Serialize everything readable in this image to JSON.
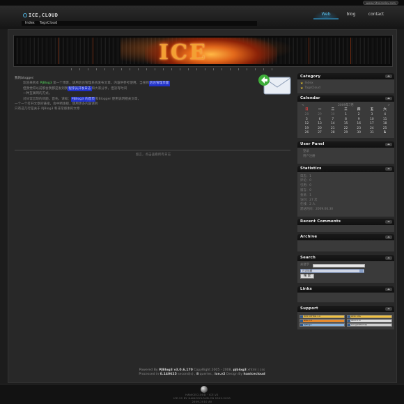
{
  "topbar": {
    "link": "www.nitroicedev.com"
  },
  "header": {
    "logo": "ICE,CLOUD",
    "nav": [
      {
        "label": "Web",
        "active": true
      },
      {
        "label": "blog",
        "active": false
      },
      {
        "label": "contact",
        "active": false
      }
    ],
    "breadcrumb": [
      "Index",
      "TagsCloud"
    ]
  },
  "banner": {
    "text": "ICE"
  },
  "post": {
    "title": "我的blogger:",
    "line1_a": "欢迎来到本 ",
    "line1_b": "PJBlog3",
    "line1_c": " 第一个博客，请用后台管理系统发布文章，内容供参考使用，当搜到",
    "line1_d": "后台管理页面",
    "line2_a": "但我觉得以前那会我都是发到我",
    "line2_b": "程序员开发日志",
    "line2_c": "和大家分享，但没有时间",
    "line3_a": "一种互联网的方式。",
    "line4_a": "对日常出现的问题，首先，请知：",
    "line4_b": "PJBlog3",
    "line4_c": "的首页",
    "line4_d": "和Blogger 使用说明相关文章，",
    "line5": "一个一个打开文章的链接，会中断连接，使用更多内容请到",
    "line6": "只有这几行是关于 PJBlog3 和非常感谢的文章",
    "more": "留言，点击查看所有日志"
  },
  "sidebar": {
    "category": {
      "title": "Category",
      "items": [
        "Index",
        "TagsCloud"
      ]
    },
    "calendar": {
      "title": "Calendar",
      "month": "2009年7月",
      "prev": "<",
      "next": ">",
      "weekdays": [
        "日",
        "一",
        "二",
        "三",
        "四",
        "五",
        "六"
      ],
      "days": [
        "28",
        "29",
        "30",
        "1",
        "2",
        "3",
        "4",
        "5",
        "6",
        "7",
        "8",
        "9",
        "10",
        "11",
        "12",
        "13",
        "14",
        "15",
        "16",
        "17",
        "18",
        "19",
        "20",
        "21",
        "22",
        "23",
        "24",
        "25",
        "26",
        "27",
        "28",
        "29",
        "30",
        "31",
        "1"
      ],
      "today": "1"
    },
    "user_panel": {
      "title": "User Panel",
      "items": [
        "登录",
        "用户注册"
      ]
    },
    "statistics": {
      "title": "Statistics",
      "items": [
        "日志：1",
        "评论：0",
        "引用：0",
        "留言：0",
        "会员：1",
        "访问：27 次",
        "在线：2 人",
        "建站时间：2009.06.30"
      ]
    },
    "recent_comments": {
      "title": "Recent Comments"
    },
    "archive": {
      "title": "Archive"
    },
    "search": {
      "title": "Search",
      "label": "关键字",
      "input_value": "",
      "select_value": "日志标题",
      "button": "搜 索"
    },
    "links": {
      "title": "Links"
    },
    "support": {
      "title": "Support",
      "badges": [
        "W3C XHTML 1.0",
        "W3C CSS",
        "RSS 2.0",
        "Atom 1.0",
        "PJBlog3",
        "GoogleSitemap"
      ]
    }
  },
  "footer": {
    "line1_a": "Powered By ",
    "line1_b": "PJBlog3 v3.0.6.170",
    "line1_c": " CopyRight 2005 - 2008, ",
    "line1_d": "pjblog3",
    "line1_e": " xhtml | css",
    "line2_a": "Processed in ",
    "line2_b": "0.140625",
    "line2_c": " second(s) , ",
    "line2_d": "8",
    "line2_e": " queries , ",
    "line2_f": "ice.v2",
    "line2_g": " Design By ",
    "line2_h": "hanicecloud"
  },
  "bottom": {
    "line1": "HANICECLOUD · ICE.V2",
    "line2": "ICE.V2 BY HANICECLOUD.CN 2009-2010",
    "line3": "2009-2010 All"
  },
  "colors": {
    "accent": "#5ac3f0",
    "highlight_green": "#53d45a",
    "highlight_blue": "#2132c9",
    "sunday_red": "#f24040"
  }
}
